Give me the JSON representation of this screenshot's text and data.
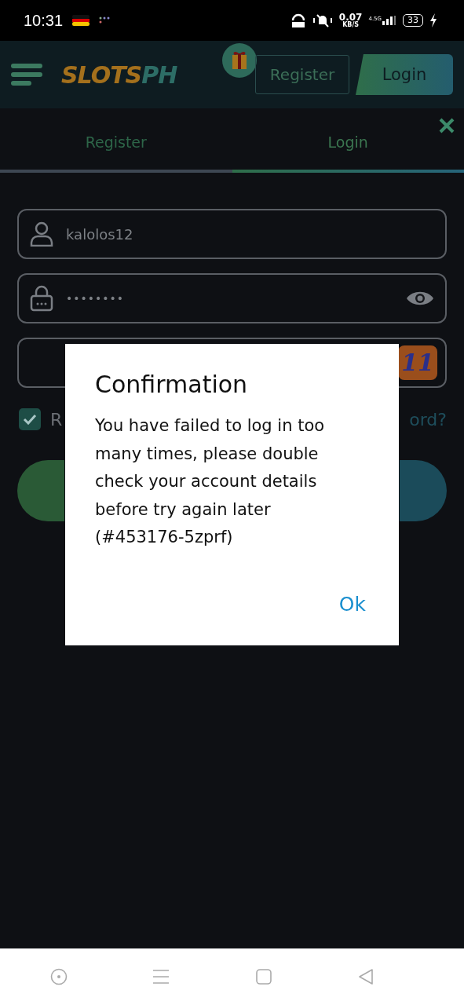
{
  "status_bar": {
    "time": "10:31",
    "network_speed": "0.07",
    "speed_unit": "KB/S",
    "signal_label": "4.5G",
    "battery": "33"
  },
  "header": {
    "logo_part_1": "SLOTS",
    "logo_part_2": "PH",
    "register_button": "Register",
    "login_button": "Login"
  },
  "tabs": [
    {
      "label": "Register",
      "selected": false
    },
    {
      "label": "Login",
      "selected": true
    }
  ],
  "form": {
    "username": "kalolos12",
    "password": "••••••••",
    "captcha_code": "11",
    "remember": {
      "label": "R",
      "checked": true
    },
    "forgot_link": "ord?"
  },
  "dialog": {
    "title": "Confirmation",
    "message": "You have failed to log in too many times, please double check your account details before try again later (#453176-5zprf)",
    "ok_button": "Ok"
  }
}
